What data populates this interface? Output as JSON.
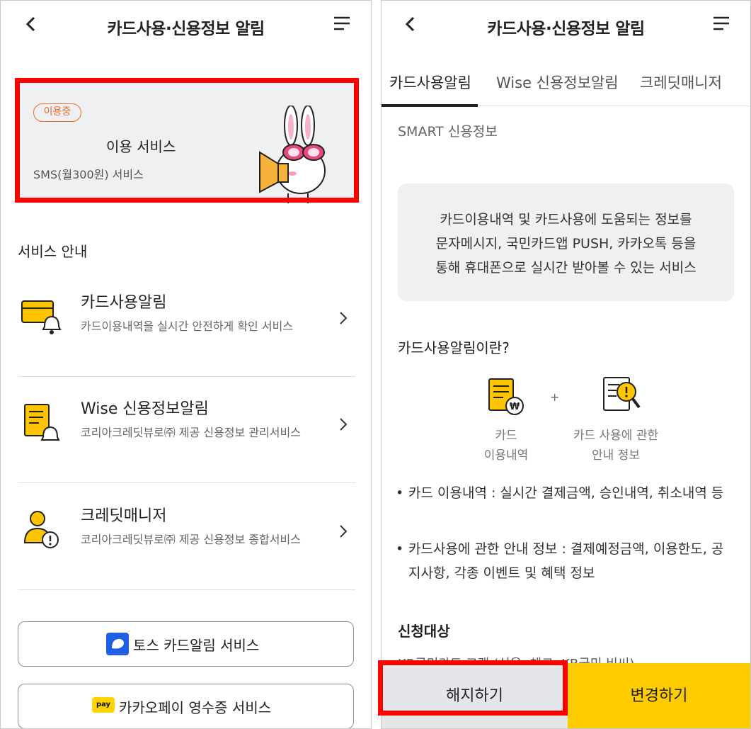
{
  "left_screen": {
    "header": {
      "title": "카드사용·신용정보 알림",
      "back_icon": "chevron-left-icon",
      "menu_icon": "menu-icon"
    },
    "usage_card": {
      "badge": "이용중",
      "title": "이용 서비스",
      "subtitle": "SMS(월300원) 서비스",
      "mascot": "rabbit-megaphone"
    },
    "section_title": "서비스 안내",
    "services": [
      {
        "name": "카드사용알림",
        "desc": "카드이용내역을 실시간 안전하게 확인 서비스",
        "icon": "card-bell-icon"
      },
      {
        "name": "Wise 신용정보알림",
        "desc": "코리아크레딧뷰로㈜ 제공 신용정보 관리서비스",
        "icon": "document-bell-icon"
      },
      {
        "name": "크레딧매니저",
        "desc": "코리아크레딧뷰로㈜ 제공 신용정보 종합서비스",
        "icon": "person-alert-icon"
      }
    ],
    "buttons": {
      "toss": "토스 카드알림 서비스",
      "kakaopay": "카카오페이 영수증 서비스",
      "kakaopay_badge": "pay"
    }
  },
  "right_screen": {
    "header": {
      "title": "카드사용·신용정보 알림",
      "back_icon": "chevron-left-icon",
      "menu_icon": "menu-icon"
    },
    "tabs": [
      "카드사용알림",
      "Wise 신용정보알림",
      "크레딧매니저"
    ],
    "active_tab": "카드사용알림",
    "subtab": "SMART 신용정보",
    "info_lines": [
      "카드이용내역 및 카드사용에 도움되는 정보를",
      "문자메시지, 국민카드앱 PUSH, 카카오톡 등을",
      "통해 휴대폰으로 실시간 받아볼 수 있는 서비스"
    ],
    "what_is_title": "카드사용알림이란?",
    "plus": "+",
    "icon1_label": [
      "카드",
      "이용내역"
    ],
    "icon2_label": [
      "카드 사용에 관한",
      "안내 정보"
    ],
    "bullets": [
      "카드 이용내역 : 실시간 결제금액, 승인내역, 취소내역 등",
      "카드사용에 관한 안내 정보 : 결제예정금액, 이용한도, 공지사항, 각종 이벤트 및 혜택 정보"
    ],
    "target_title": "신청대상",
    "target_partial": "KB국민카드 고객 (신용, 체크, KB국민 비씨)",
    "cancel_button": "해지하기",
    "change_button": "변경하기"
  },
  "colors": {
    "highlight": "#ff0000",
    "badge": "#f06a2a",
    "accent_yellow": "#ffcc00",
    "toss_blue": "#1f5fe8",
    "card_bg": "#eef0f1"
  }
}
